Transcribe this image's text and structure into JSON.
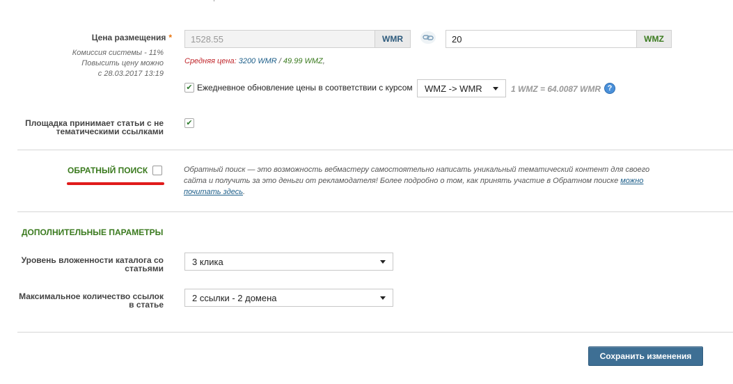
{
  "price": {
    "label": "Цена размещения",
    "required_mark": "*",
    "hint_commission": "Комиссия системы - 11%",
    "hint_raise": "Повысить цену можно",
    "hint_date": "с 28.03.2017 13:19",
    "wmr_value": "1528.55",
    "wmr_label": "WMR",
    "wmz_value": "20",
    "wmz_label": "WMZ",
    "avg_prefix": "Средняя цена:",
    "avg_wmr": "3200 WMR",
    "avg_sep": "/",
    "avg_wmz": "49.99 WMZ",
    "avg_suffix": ",",
    "daily_update_label": "Ежедневное обновление цены в соответствии с курсом",
    "rate_select": "WMZ -> WMR",
    "rate_text": "1 WMZ = 64.0087 WMR",
    "help_glyph": "?"
  },
  "non_thematic": {
    "label_line1": "Площадка принимает статьи с не",
    "label_line2": "тематическими ссылками"
  },
  "reverse_search": {
    "label": "ОБРАТНЫЙ ПОИСК",
    "description": "Обратный поиск — это возможность вебмастеру самостоятельно написать уникальный тематический контент для своего сайта и получить за это деньги от рекламодателя! Более подробно о том, как принять участие в Обратном поиске",
    "link_text": "можно почитать здесь",
    "period": "."
  },
  "additional": {
    "title": "ДОПОЛНИТЕЛЬНЫЕ ПАРАМЕТРЫ",
    "depth_label_line1": "Уровень вложенности каталога со",
    "depth_label_line2": "статьями",
    "depth_value": "3 клика",
    "max_links_label_line1": "Максимальное количество ссылок",
    "max_links_label_line2": "в статье",
    "max_links_value": "2 ссылки - 2 домена"
  },
  "save_button": "Сохранить изменения",
  "colors": {
    "accent_green": "#3a7a1e",
    "link_blue": "#1e5f8a",
    "red_underline": "#e01b1b",
    "button_blue": "#3e6f94"
  }
}
